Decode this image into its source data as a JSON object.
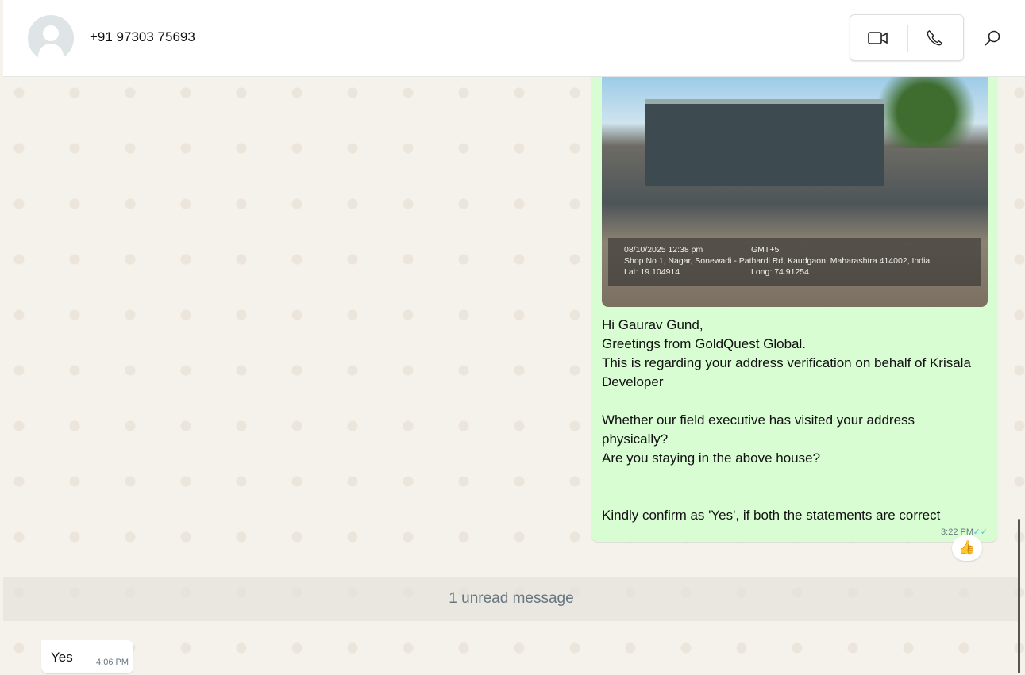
{
  "header": {
    "contact": "+91 97303 75693"
  },
  "photo_overlay": {
    "datetime": "08/10/2025 12:38 pm",
    "tz": "GMT+5",
    "address": "Shop No 1, Nagar, Sonewadi - Pathardi Rd, Kaudgaon, Maharashtra 414002, India",
    "lat": "Lat: 19.104914",
    "long": "Long: 74.91254"
  },
  "outgoing": {
    "text": "Hi Gaurav Gund,\nGreetings from GoldQuest Global.\nThis is regarding your address verification on behalf of Krisala Developer\n\nWhether our field executive has visited your address physically?\nAre you staying in the above house?\n\n\nKindly confirm as 'Yes', if both the statements are correct",
    "time": "3:22 PM",
    "ticks": "✓✓",
    "reaction": "👍"
  },
  "unread": "1 unread message",
  "incoming": {
    "text": "Yes",
    "time": "4:06 PM"
  }
}
